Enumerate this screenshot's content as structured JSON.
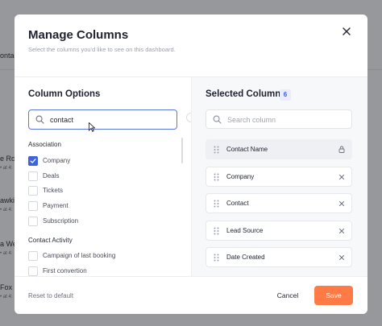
{
  "background": {
    "rows": [
      {
        "title": "ontac",
        "sub": ""
      },
      {
        "title": "e Ro",
        "sub": "• at 4:"
      },
      {
        "title": "awkin",
        "sub": "• at 4:"
      },
      {
        "title": "a We",
        "sub": "• at 4:"
      },
      {
        "title": "Fox",
        "sub": "• at 4:"
      }
    ]
  },
  "modal": {
    "title": "Manage Columns",
    "subtitle": "Select the columns you'd like to see on this dashboard.",
    "close_icon": "close-icon"
  },
  "left": {
    "title": "Column Options",
    "search_value": "contact",
    "search_placeholder": "Search column",
    "groups": [
      {
        "label": "Association",
        "options": [
          {
            "label": "Company",
            "checked": true
          },
          {
            "label": "Deals",
            "checked": false
          },
          {
            "label": "Tickets",
            "checked": false
          },
          {
            "label": "Payment",
            "checked": false
          },
          {
            "label": "Subscription",
            "checked": false
          }
        ]
      },
      {
        "label": "Contact Activity",
        "options": [
          {
            "label": "Campaign of last booking",
            "checked": false
          },
          {
            "label": "First convertion",
            "checked": false
          }
        ]
      }
    ]
  },
  "right": {
    "title": "Selected Column",
    "count": "6",
    "search_placeholder": "Search column",
    "items": [
      {
        "label": "Contact Name",
        "action": "lock-icon"
      },
      {
        "label": "Company",
        "action": "remove-icon"
      },
      {
        "label": "Contact",
        "action": "remove-icon"
      },
      {
        "label": "Lead Source",
        "action": "remove-icon"
      },
      {
        "label": "Date Created",
        "action": "remove-icon"
      }
    ]
  },
  "footer": {
    "reset_label": "Reset to default",
    "cancel_label": "Cancel",
    "save_label": "Save"
  },
  "colors": {
    "accent": "#3f63d9",
    "primary_button": "#ff7a45",
    "badge_bg": "#e8ecfb"
  }
}
